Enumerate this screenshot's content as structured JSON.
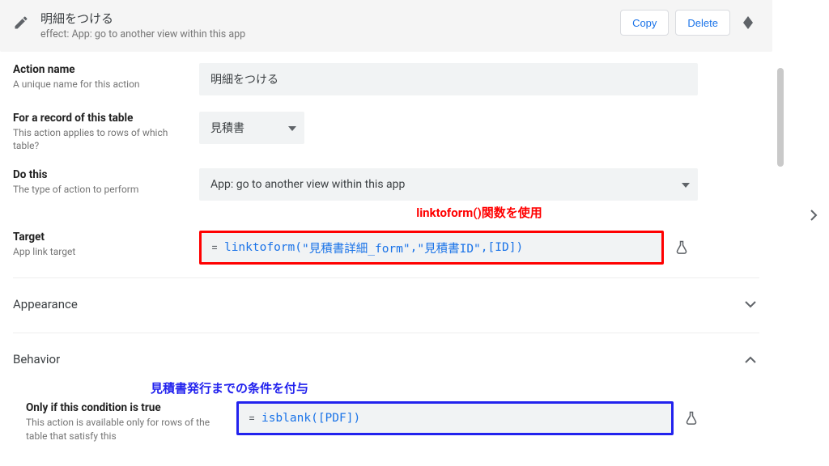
{
  "header": {
    "title": "明細をつける",
    "subtitle_prefix": "effect: ",
    "subtitle_value": "App: go to another view within this app",
    "copy_label": "Copy",
    "delete_label": "Delete"
  },
  "fields": {
    "action_name": {
      "label": "Action name",
      "desc": "A unique name for this action",
      "value": "明細をつける"
    },
    "table": {
      "label": "For a record of this table",
      "desc": "This action applies to rows of which table?",
      "value": "見積書"
    },
    "do_this": {
      "label": "Do this",
      "desc": "The type of action to perform",
      "value": "App: go to another view within this app"
    },
    "target": {
      "label": "Target",
      "desc": "App link target",
      "eq": "=",
      "fn": "linktoform",
      "lp": "(",
      "a1": "\"見積書詳細_form\"",
      "c1": ",",
      "a2": "\"見積書ID\"",
      "c2": ",",
      "a3": "[ID]",
      "rp": ")"
    },
    "condition": {
      "label": "Only if this condition is true",
      "desc": "This action is available only for rows of the table that satisfy this",
      "eq": "=",
      "fn": "isblank",
      "lp": "(",
      "a1": "[PDF]",
      "rp": ")"
    }
  },
  "annotations": {
    "red": "linktoform()関数を使用",
    "blue": "見積書発行までの条件を付与"
  },
  "sections": {
    "appearance": "Appearance",
    "behavior": "Behavior"
  }
}
